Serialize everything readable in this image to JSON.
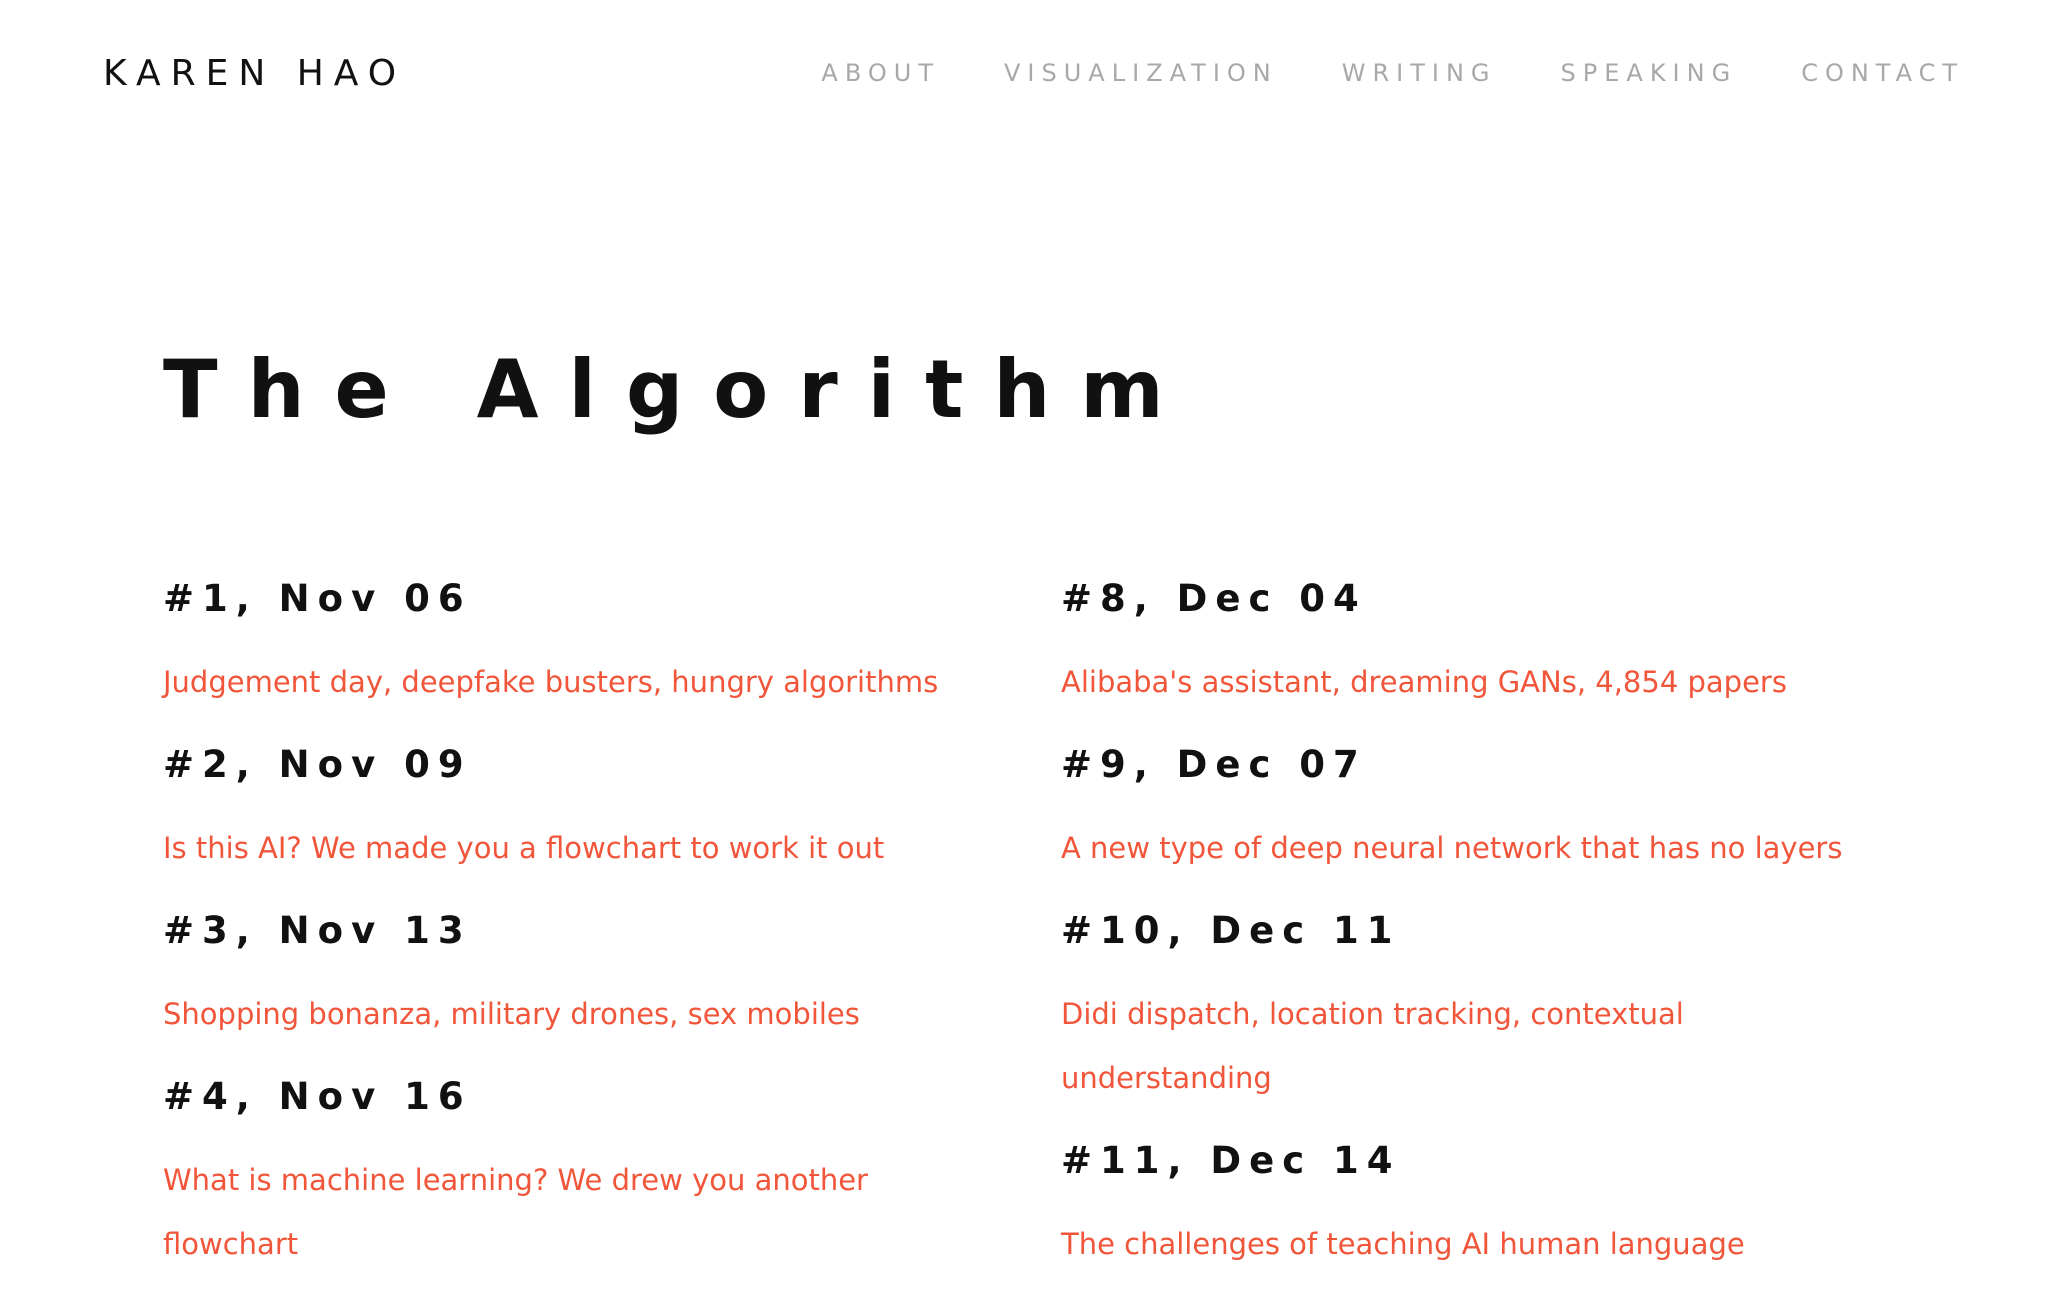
{
  "header": {
    "site_title": "KAREN HAO",
    "nav": [
      {
        "label": "ABOUT"
      },
      {
        "label": "VISUALIZATION"
      },
      {
        "label": "WRITING"
      },
      {
        "label": "SPEAKING"
      },
      {
        "label": "CONTACT"
      }
    ]
  },
  "main": {
    "title": "The Algorithm",
    "left_column": [
      {
        "heading": "#1, Nov 06",
        "link": "Judgement day, deepfake busters, hungry algorithms"
      },
      {
        "heading": "#2, Nov 09",
        "link": "Is this AI? We made you a flowchart to work it out"
      },
      {
        "heading": "#3, Nov 13",
        "link": "Shopping bonanza, military drones, sex mobiles"
      },
      {
        "heading": "#4, Nov 16",
        "link": "What is machine learning? We drew you another flowchart"
      }
    ],
    "right_column": [
      {
        "heading": "#8, Dec 04",
        "link": "Alibaba's assistant, dreaming GANs, 4,854 papers"
      },
      {
        "heading": "#9, Dec 07",
        "link": "A new type of deep neural network that has no layers"
      },
      {
        "heading": "#10, Dec 11",
        "link": "Didi dispatch, location tracking, contextual understanding"
      },
      {
        "heading": "#11, Dec 14",
        "link": "The challenges of teaching AI human language"
      }
    ]
  },
  "colors": {
    "heading_text": "#111111",
    "nav_text": "#a8a8a8",
    "link_accent": "#f1553a",
    "background": "#ffffff"
  }
}
